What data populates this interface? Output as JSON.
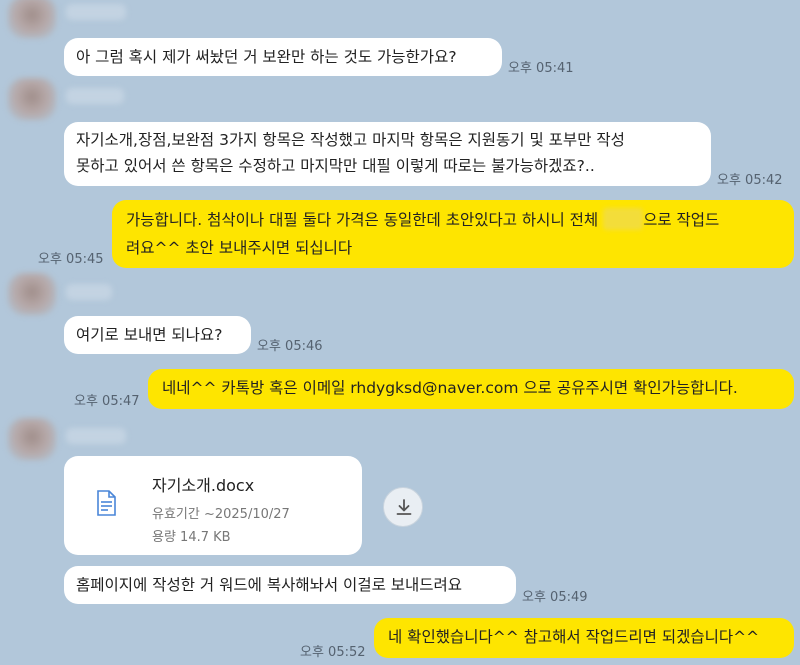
{
  "messages": [
    {
      "text": "아 그럼 혹시 제가 써놨던 거 보완만 하는 것도 가능한가요?",
      "time": "오후 05:41"
    },
    {
      "lines": [
        "자기소개,장점,보완점 3가지 항목은 작성했고 마지막 항목은 지원동기 및 포부만 작성",
        "못하고 있어서 쓴 항목은 수정하고 마지막만 대필 이렇게 따로는 불가능하겠죠?.."
      ],
      "time": "오후 05:42"
    },
    {
      "line1_a": "가능합니다. 첨삭이나 대필 둘다 가격은 동일한데 초안있다고 하시니 전체",
      "line1_b": "으로 작업드",
      "line2": "려요^^ 초안 보내주시면 되십니다",
      "time": "오후 05:45"
    },
    {
      "text": "여기로 보내면 되나요?",
      "time": "오후 05:46"
    },
    {
      "text": "네네^^ 카톡방 혹은 이메일 rhdygksd@naver.com 으로 공유주시면 확인가능합니다.",
      "time": "오후 05:47"
    },
    {
      "text": "홈페이지에 작성한 거 워드에 복사해놔서 이걸로 보내드려요",
      "time": "오후 05:49"
    },
    {
      "text": "네 확인했습니다^^ 참고해서 작업드리면 되겠습니다^^",
      "time": "오후 05:52"
    }
  ],
  "file": {
    "name": "자기소개.docx",
    "expiry": "유효기간 ~2025/10/27",
    "size": "용량 14.7 KB"
  },
  "colors": {
    "background": "#b2c7da",
    "incoming_bubble": "#ffffff",
    "outgoing_bubble": "#fee500"
  },
  "icons": {
    "file": "document-icon",
    "download": "download-icon"
  }
}
